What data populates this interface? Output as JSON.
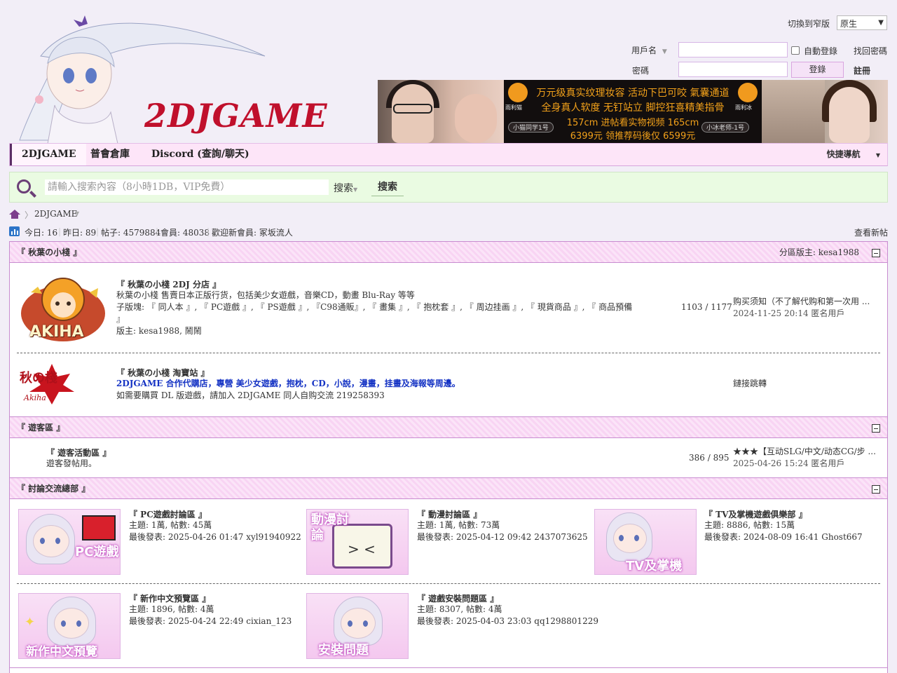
{
  "header": {
    "logo_text": "2DJGAME",
    "narrow_switch": "切換到窄版",
    "narrow_select": "原生",
    "username_label": "用戶名",
    "password_label": "密碼",
    "auto_login": "自動登錄",
    "forgot_password": "找回密碼",
    "login_button": "登錄",
    "register": "註冊"
  },
  "banner": {
    "line1": "万元级真实纹理妆容 活动下巴可咬 氣囊通道",
    "line2": "全身真人软度 无钉站立 脚控狂喜精美指骨",
    "line3a": "157cm 进帖看实物视频 165cm",
    "line4a": "6399元",
    "line4b": "领推荐码後仅",
    "line4c": "6599元",
    "brand_left": "雨利猫",
    "brand_right": "雨利冰",
    "tag_left": "小猫同学1号",
    "tag_right": "小冰老师-1号"
  },
  "nav": {
    "items": [
      {
        "label": "2DJGAME"
      },
      {
        "label": "普會倉庫"
      },
      {
        "label": "Discord (查詢/聊天)"
      }
    ],
    "quick": "快捷導航"
  },
  "search": {
    "placeholder": "請輸入搜索內容（8小時1DB，VIP免費）",
    "type": "搜索",
    "button": "搜索"
  },
  "breadcrumb": {
    "current": "2DJGAME"
  },
  "stats": {
    "today": "今日: 16",
    "yesterday": "昨日: 89",
    "posts": "帖子: 4579884",
    "members": "會員: 48038",
    "newest": "歡迎新會員: 冢坂流人",
    "view_new": "查看新帖"
  },
  "categories": {
    "akiha": {
      "title": "『 秋葉の小棧 』",
      "mod": "分區版主: kesa1988",
      "forum1": {
        "title": "『 秋葉の小棧 2DJ 分店 』",
        "desc": "秋葉の小棧 售賣日本正版行货，包括美少女遊戲，音樂CD，動畫 Blu-Ray 等等",
        "sub": "子版塊: 『 同人本 』, 『 PC遊戲 』, 『 PS遊戲 』, 『C98通販』, 『 畫集 』, 『 抱枕套 』, 『 周边挂画 』, 『 現貨商品 』, 『 商品預備",
        "sub2": "』",
        "mods": "版主: kesa1988, 鬧鬧",
        "count": "1103 / 1177",
        "last_title": "购买须知（不了解代购和第一次用 ...",
        "last_meta": "2024-11-25 20:14 匿名用戶",
        "logo_text": "AKIHA"
      },
      "forum2": {
        "title": "『 秋葉の小棧 淘寶站 』",
        "desc": "2DJGAME 合作代購店，專營 美少女遊戲，抱枕，CD，小說，漫畫，挂畫及海報等周邊。",
        "desc2": "如需要購買 DL 版遊戲，請加入 2DJGAME 同人自购交流 219258393",
        "last": "鏈接跳轉",
        "logo_text": "秋の棧",
        "logo_sub": "Akiha"
      }
    },
    "guest": {
      "title": "『 遊客區 』",
      "forum": {
        "title": "『 遊客活動區 』",
        "desc": "遊客發帖用。",
        "count": "386 / 895",
        "last_title": "★★★【互动SLG/中文/动态CG/步 ...",
        "last_meta": "2025-04-26 15:24 匿名用戶"
      }
    },
    "discuss": {
      "title": "『 討論交流總部 』",
      "forums": [
        {
          "title": "『 PC遊戲討論區 』",
          "stats": "主題: 1萬, 帖數: 45萬",
          "last": "最後發表: 2025-04-26 01:47 xyl91940922",
          "thumb": "PC遊戲"
        },
        {
          "title": "『 動漫討論區 』",
          "stats": "主題: 1萬, 帖數: 73萬",
          "last": "最後發表: 2025-04-12 09:42 2437073625",
          "thumb": "動漫討論"
        },
        {
          "title": "『 TV及掌機遊戲俱樂部 』",
          "stats": "主題: 8886, 帖數: 15萬",
          "last": "最後發表: 2024-08-09 16:41 Ghost667",
          "thumb": "TV及掌機"
        },
        {
          "title": "『 新作中文預覽區 』",
          "stats": "主題: 1896, 帖數: 4萬",
          "last": "最後發表: 2025-04-24 22:49 cixian_123",
          "thumb": "新作中文預覽"
        },
        {
          "title": "『 遊戲安裝問題區 』",
          "stats": "主題: 8307, 帖數: 4萬",
          "last": "最後發表: 2025-04-03 23:03 qq1298801229",
          "thumb": "安裝問題"
        }
      ]
    }
  },
  "colors": {
    "nav_bg": "#fde5f8",
    "search_bg": "#eafbe2",
    "accent": "#7d3f8c",
    "link_blue": "#1533c4",
    "logo_red": "#c0102c"
  }
}
